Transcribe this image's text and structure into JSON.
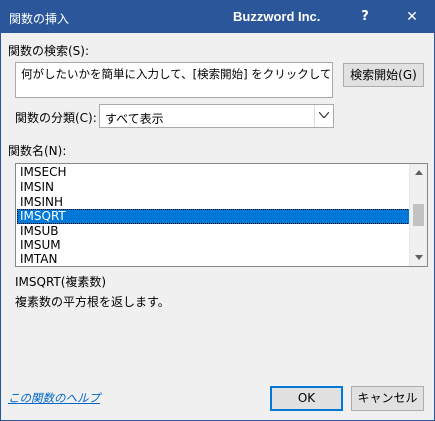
{
  "titlebar": {
    "title": "関数の挿入",
    "brand": "Buzzword Inc.",
    "help_label": "?",
    "close_label": "✕"
  },
  "search": {
    "label": "関数の検索(S):",
    "text": "何がしたいかを簡単に入力して、[検索開始] をクリックしてください。",
    "button_label": "検索開始(G)"
  },
  "category": {
    "label": "関数の分類(C):",
    "selected": "すべて表示"
  },
  "function_list": {
    "label": "関数名(N):",
    "items": [
      "IMSECH",
      "IMSIN",
      "IMSINH",
      "IMSQRT",
      "IMSUB",
      "IMSUM",
      "IMTAN"
    ],
    "selected": "IMSQRT"
  },
  "description": {
    "signature": "IMSQRT(複素数)",
    "text": "複素数の平方根を返します。"
  },
  "footer": {
    "help_link": "この関数のヘルプ",
    "ok_label": "OK",
    "cancel_label": "キャンセル"
  },
  "colors": {
    "titlebar": "#2b579a",
    "selection": "#0078d7",
    "link": "#0066cc"
  }
}
